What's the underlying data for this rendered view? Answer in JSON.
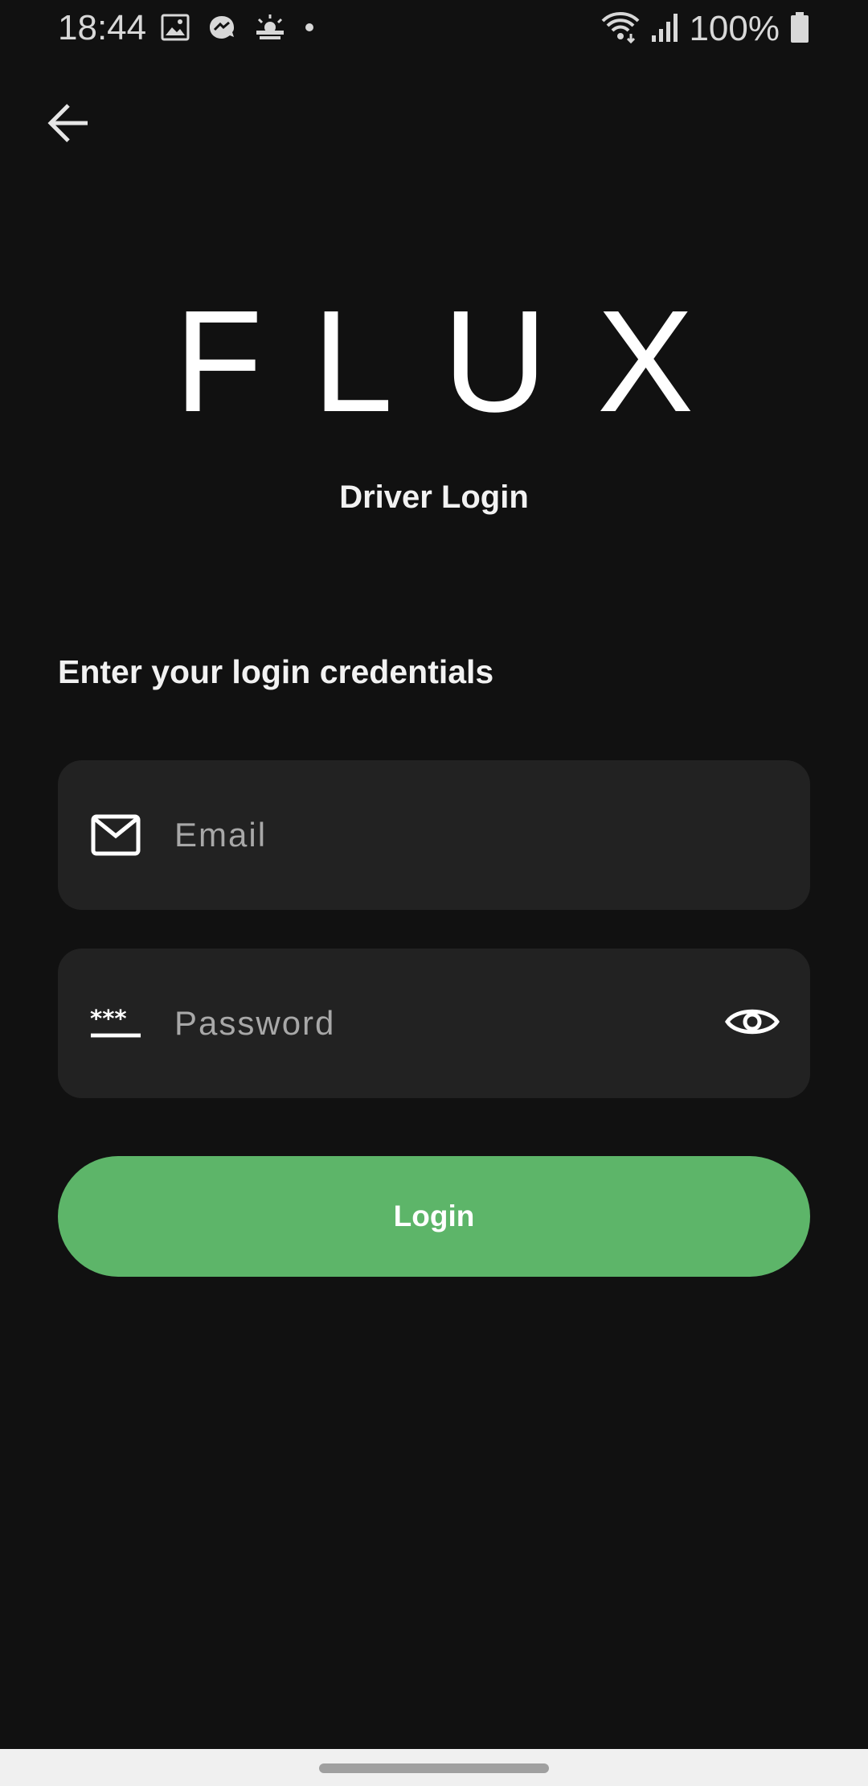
{
  "status_bar": {
    "time": "18:44",
    "battery_text": "100%",
    "left_icons": [
      "image-icon",
      "messenger-icon",
      "weather-icon",
      "dot-icon"
    ],
    "right_icons": [
      "wifi-icon",
      "signal-icon",
      "battery-icon"
    ]
  },
  "header": {
    "back_icon": "arrow-left-icon"
  },
  "brand": {
    "logo_text": "FLUX",
    "subtitle": "Driver Login"
  },
  "form": {
    "heading": "Enter your login credentials",
    "email": {
      "placeholder": "Email",
      "value": "",
      "icon": "mail-icon"
    },
    "password": {
      "placeholder": "Password",
      "value": "",
      "icon": "password-icon",
      "toggle_icon": "eye-icon"
    },
    "submit_label": "Login"
  },
  "colors": {
    "background": "#111111",
    "field_background": "#222222",
    "accent": "#5db569",
    "nav_bar": "#f0f0f0"
  }
}
